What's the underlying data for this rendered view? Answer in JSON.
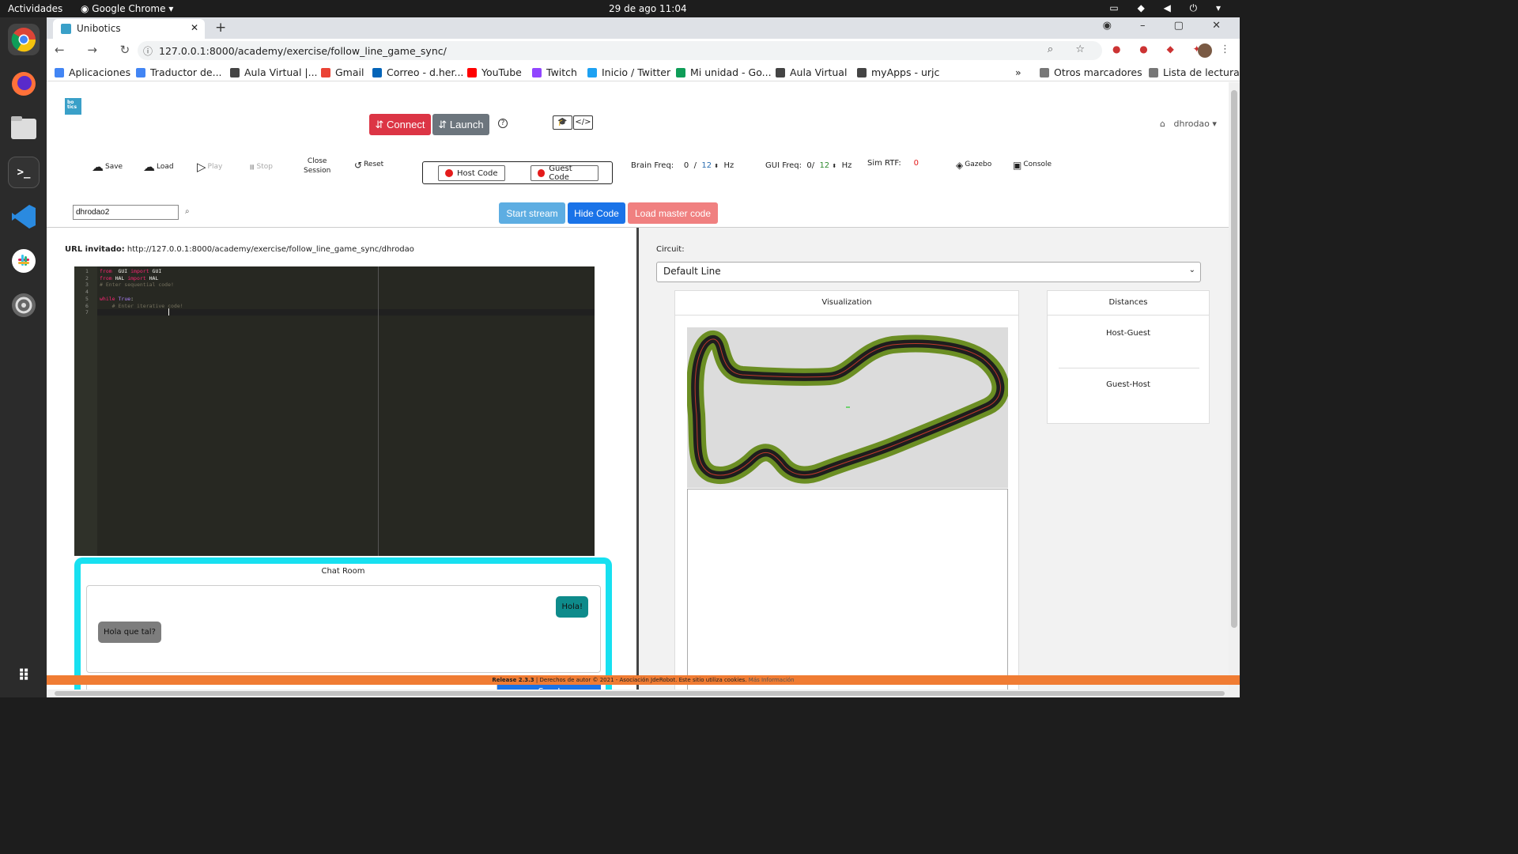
{
  "system": {
    "activities": "Actividades",
    "app": "Google Chrome",
    "clock": "29 de ago  11:04"
  },
  "browser": {
    "tab_title": "Unibotics",
    "url": "127.0.0.1:8000/academy/exercise/follow_line_game_sync/",
    "bookmarks": [
      {
        "label": "Aplicaciones",
        "icon": "apps-grid-icon",
        "color": "#4285f4"
      },
      {
        "label": "Traductor de...",
        "icon": "translate-icon",
        "color": "#4285f4"
      },
      {
        "label": "Aula Virtual |...",
        "icon": "urjc-icon",
        "color": "#444444"
      },
      {
        "label": "Gmail",
        "icon": "gmail-icon",
        "color": "#ea4335"
      },
      {
        "label": "Correo - d.her...",
        "icon": "outlook-icon",
        "color": "#0364b8"
      },
      {
        "label": "YouTube",
        "icon": "youtube-icon",
        "color": "#ff0000"
      },
      {
        "label": "Twitch",
        "icon": "twitch-icon",
        "color": "#9146ff"
      },
      {
        "label": "Inicio / Twitter",
        "icon": "twitter-icon",
        "color": "#1da1f2"
      },
      {
        "label": "Mi unidad - Go...",
        "icon": "drive-icon",
        "color": "#0f9d58"
      },
      {
        "label": "Aula Virtual",
        "icon": "urjc-icon",
        "color": "#444444"
      },
      {
        "label": "myApps - urjc",
        "icon": "urjc-icon",
        "color": "#444444"
      }
    ],
    "other_bookmarks": "Otros marcadores",
    "reading_list": "Lista de lectura"
  },
  "header": {
    "connect": "⇵ Connect",
    "launch": "⇵ Launch",
    "user": "dhrodao ▾",
    "colors": {
      "connect": "#dc3545",
      "launch": "#6c757d"
    }
  },
  "toolbar": {
    "save": "Save",
    "load": "Load",
    "play": "Play",
    "stop": "Stop",
    "close_session_1": "Close",
    "close_session_2": "Session",
    "reset": "Reset",
    "host_code": "Host Code",
    "guest_code": "Guest Code",
    "brain_freq_label": "Brain Freq:",
    "brain_freq_value": "0",
    "brain_freq_sep": "/",
    "brain_freq_max": "12",
    "gui_freq_label": "GUI Freq:",
    "gui_freq_value": "0/",
    "gui_freq_max": "12",
    "hz": "Hz",
    "sim_rtf_label": "Sim RTF:",
    "sim_rtf_value": "0",
    "gazebo": "Gazebo",
    "console": "Console"
  },
  "session": {
    "username_value": "dhrodao2",
    "start_stream": "Start stream",
    "hide_code": "Hide Code",
    "load_master": "Load master code",
    "colors": {
      "start_stream": "#5dade2",
      "hide_code": "#1a73e8",
      "load_master": "#f08080"
    }
  },
  "invite": {
    "label": "URL invitado:",
    "url": "http://127.0.0.1:8000/academy/exercise/follow_line_game_sync/dhrodao"
  },
  "code_lines": [
    {
      "n": "1",
      "parts": [
        [
          "kw",
          "from"
        ],
        [
          "",
          "  GUI "
        ],
        [
          "kw",
          "import"
        ],
        [
          "",
          " GUI"
        ]
      ]
    },
    {
      "n": "2",
      "parts": [
        [
          "kw",
          "from"
        ],
        [
          "",
          " HAL "
        ],
        [
          "kw",
          "import"
        ],
        [
          "",
          " HAL"
        ]
      ]
    },
    {
      "n": "3",
      "parts": [
        [
          "cm",
          "# Enter sequential code!"
        ]
      ]
    },
    {
      "n": "4",
      "parts": []
    },
    {
      "n": "5",
      "parts": [
        [
          "kw",
          "while"
        ],
        [
          "",
          " "
        ],
        [
          "tr",
          "True"
        ],
        [
          "",
          ":"
        ]
      ]
    },
    {
      "n": "6",
      "parts": [
        [
          "cm",
          "    # Enter iterative code!"
        ]
      ]
    },
    {
      "n": "7",
      "parts": []
    }
  ],
  "chat": {
    "title": "Chat Room",
    "messages": [
      {
        "from": "me",
        "text": "Hola!"
      },
      {
        "from": "other",
        "text": "Hola que tal?"
      }
    ],
    "send": "Send"
  },
  "circuit": {
    "label": "Circuit:",
    "selected": "Default Line"
  },
  "visualization": {
    "title": "Visualization"
  },
  "distances": {
    "title": "Distances",
    "host_guest": "Host-Guest",
    "guest_host": "Guest-Host"
  },
  "footer": {
    "release": "Release 2.3.3",
    "text": " | Derechos de autor © 2021 - Asociación JdeRobot. Este sitio utiliza cookies. ",
    "more": "Más Información"
  }
}
